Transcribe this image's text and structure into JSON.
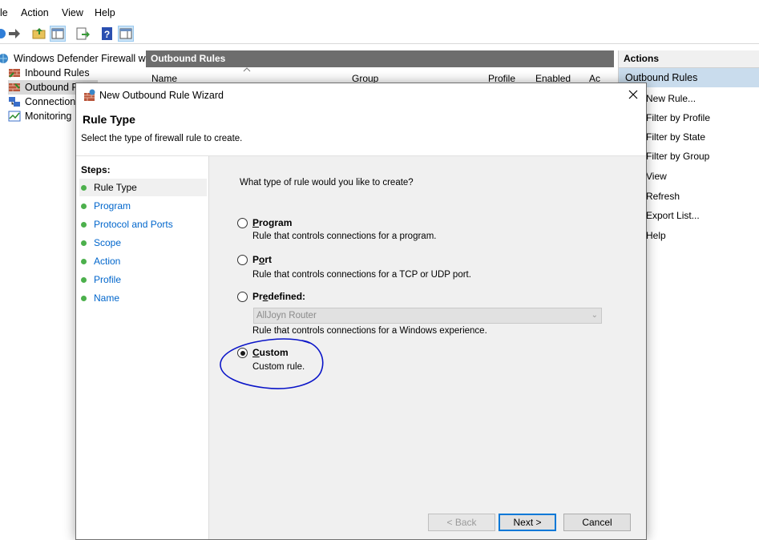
{
  "menu": {
    "file": "le",
    "action": "Action",
    "view": "View",
    "help": "Help"
  },
  "toolbar": {
    "icons": [
      "back-arrow-icon",
      "forward-arrow-icon",
      "folder-up-icon",
      "show-hide-console-tree-icon",
      "export-list-icon",
      "help-icon",
      "properties-pane-icon"
    ]
  },
  "tree": {
    "root": "Windows Defender Firewall witl",
    "items": [
      "Inbound Rules",
      "Outbound R",
      "Connection",
      "Monitoring"
    ]
  },
  "center": {
    "title": "Outbound Rules",
    "columns": [
      "Name",
      "Group",
      "Profile",
      "Enabled",
      "Ac"
    ]
  },
  "actions": {
    "header": "Actions",
    "subheader": "Outbound Rules",
    "items": [
      "New Rule...",
      "Filter by Profile",
      "Filter by State",
      "Filter by Group",
      "View",
      "Refresh",
      "Export List...",
      "Help"
    ]
  },
  "dialog": {
    "title": "New Outbound Rule Wizard",
    "page_title": "Rule Type",
    "page_desc": "Select the type of firewall rule to create.",
    "steps_header": "Steps:",
    "steps": [
      "Rule Type",
      "Program",
      "Protocol and Ports",
      "Scope",
      "Action",
      "Profile",
      "Name"
    ],
    "current_step": "Rule Type",
    "question": "What type of rule would you like to create?",
    "options": [
      {
        "key": "program",
        "mnemonic": "P",
        "rest": "rogram",
        "desc": "Rule that controls connections for a program.",
        "selected": false
      },
      {
        "key": "port",
        "pre": "P",
        "mnemonic": "o",
        "rest": "rt",
        "desc": "Rule that controls connections for a TCP or UDP port.",
        "selected": false
      },
      {
        "key": "predefined",
        "pre": "Pr",
        "mnemonic": "e",
        "rest": "defined:",
        "desc": "Rule that controls connections for a Windows experience.",
        "selected": false
      },
      {
        "key": "custom",
        "mnemonic": "C",
        "rest": "ustom",
        "desc": "Custom rule.",
        "selected": true
      }
    ],
    "predefined_value": "AllJoyn Router",
    "buttons": {
      "back": "< Back",
      "next": "Next >",
      "cancel": "Cancel"
    }
  },
  "colors": {
    "annotation_circle": "#0a14c8",
    "link": "#0066cc",
    "step_dot": "#4cb04c"
  }
}
